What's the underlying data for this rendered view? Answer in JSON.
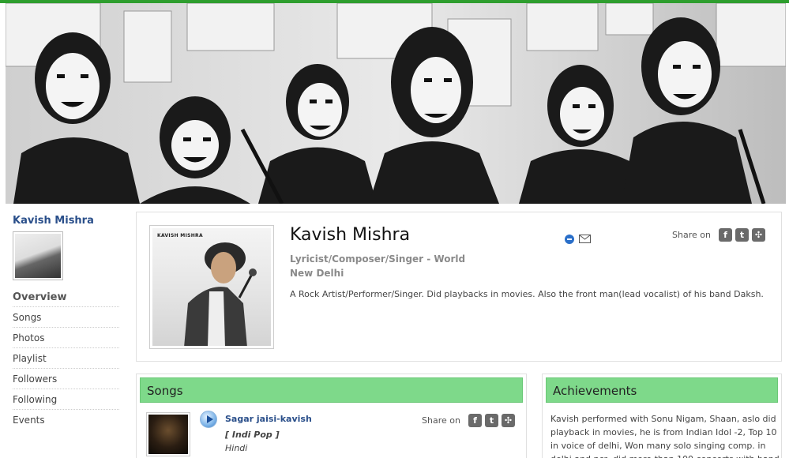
{
  "profile": {
    "name": "Kavish Mishra",
    "role": "Lyricist/Composer/Singer - World",
    "city": "New Delhi",
    "description": "A Rock Artist/Performer/Singer. Did playbacks in movies. Also the front man(lead vocalist) of his band Daksh.",
    "photo_caption": "KAVISH MISHRA",
    "share_label": "Share on"
  },
  "sidebar": {
    "name": "Kavish Mishra",
    "nav_title": "Overview",
    "items": [
      {
        "label": "Songs"
      },
      {
        "label": "Photos"
      },
      {
        "label": "Playlist"
      },
      {
        "label": "Followers"
      },
      {
        "label": "Following"
      },
      {
        "label": "Events"
      }
    ]
  },
  "songs": {
    "heading": "Songs",
    "items": [
      {
        "title": "Sagar jaisi-kavish",
        "genre": "[ Indi Pop ]",
        "language": "Hindi",
        "share_label": "Share on"
      }
    ]
  },
  "achievements": {
    "heading": "Achievements",
    "text": "Kavish performed with Sonu Nigam, Shaan, aslo did playback in movies, he is from Indian Idol -2, Top 10 in voice of delhi, Won many solo singing comp. in delhi and ncr, did more than 100 concerts with band"
  },
  "share_icons": [
    "facebook-icon",
    "twitter-icon",
    "myspace-icon"
  ],
  "colors": {
    "accent_green": "#7ed98a",
    "top_line": "#2e9e2e",
    "link_blue": "#2a4f8a",
    "muted_text": "#8a8a8a"
  }
}
